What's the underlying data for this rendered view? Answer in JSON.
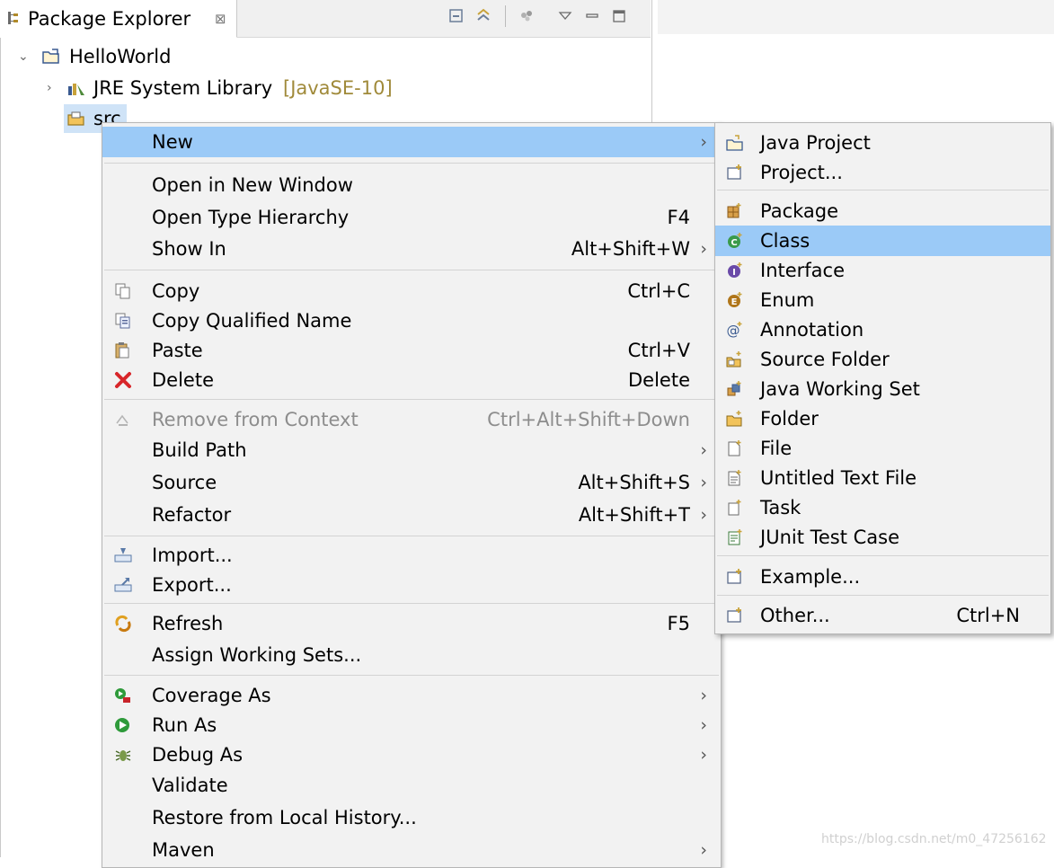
{
  "view": {
    "title": "Package Explorer",
    "close_glyph": "⊠",
    "toolbar": [
      "collapse-all-icon",
      "link-with-editor-icon",
      "filters-icon",
      "view-menu-icon",
      "minimize-icon",
      "maximize-icon"
    ]
  },
  "tree": [
    {
      "label": "HelloWorld",
      "decoration": "",
      "twisty": "⌄",
      "icon": "java-project-icon"
    },
    {
      "label": "JRE System Library",
      "decoration": "[JavaSE-10]",
      "twisty": "›",
      "icon": "library-icon"
    },
    {
      "label": "src",
      "decoration": "",
      "twisty": "",
      "icon": "source-folder-icon"
    }
  ],
  "context_menu": {
    "items": [
      {
        "label": "New",
        "accel": "",
        "arrow": "›",
        "icon": "",
        "highlighted": true
      },
      {
        "label": "Open in New Window",
        "accel": "",
        "arrow": "",
        "icon": ""
      },
      {
        "label": "Open Type Hierarchy",
        "accel": "F4",
        "arrow": "",
        "icon": ""
      },
      {
        "label": "Show In",
        "accel": "Alt+Shift+W",
        "arrow": "›",
        "icon": ""
      },
      {
        "label": "Copy",
        "accel": "Ctrl+C",
        "arrow": "",
        "icon": "copy-icon"
      },
      {
        "label": "Copy Qualified Name",
        "accel": "",
        "arrow": "",
        "icon": "copy-qualified-name-icon"
      },
      {
        "label": "Paste",
        "accel": "Ctrl+V",
        "arrow": "",
        "icon": "paste-icon"
      },
      {
        "label": "Delete",
        "accel": "Delete",
        "arrow": "",
        "icon": "delete-icon"
      },
      {
        "label": "Remove from Context",
        "accel": "Ctrl+Alt+Shift+Down",
        "arrow": "",
        "icon": "remove-context-icon",
        "disabled": true
      },
      {
        "label": "Build Path",
        "accel": "",
        "arrow": "›",
        "icon": ""
      },
      {
        "label": "Source",
        "accel": "Alt+Shift+S",
        "arrow": "›",
        "icon": ""
      },
      {
        "label": "Refactor",
        "accel": "Alt+Shift+T",
        "arrow": "›",
        "icon": ""
      },
      {
        "label": "Import...",
        "accel": "",
        "arrow": "",
        "icon": "import-icon"
      },
      {
        "label": "Export...",
        "accel": "",
        "arrow": "",
        "icon": "export-icon"
      },
      {
        "label": "Refresh",
        "accel": "F5",
        "arrow": "",
        "icon": "refresh-icon"
      },
      {
        "label": "Assign Working Sets...",
        "accel": "",
        "arrow": "",
        "icon": ""
      },
      {
        "label": "Coverage As",
        "accel": "",
        "arrow": "›",
        "icon": "coverage-icon"
      },
      {
        "label": "Run As",
        "accel": "",
        "arrow": "›",
        "icon": "run-icon"
      },
      {
        "label": "Debug As",
        "accel": "",
        "arrow": "›",
        "icon": "debug-icon"
      },
      {
        "label": "Validate",
        "accel": "",
        "arrow": "",
        "icon": ""
      },
      {
        "label": "Restore from Local History...",
        "accel": "",
        "arrow": "",
        "icon": ""
      },
      {
        "label": "Maven",
        "accel": "",
        "arrow": "›",
        "icon": ""
      }
    ]
  },
  "new_submenu": {
    "items": [
      {
        "label": "Java Project",
        "accel": "",
        "icon": "java-project-wizard-icon"
      },
      {
        "label": "Project...",
        "accel": "",
        "icon": "project-wizard-icon"
      },
      {
        "label": "Package",
        "accel": "",
        "icon": "package-icon"
      },
      {
        "label": "Class",
        "accel": "",
        "icon": "class-icon",
        "highlighted": true
      },
      {
        "label": "Interface",
        "accel": "",
        "icon": "interface-icon"
      },
      {
        "label": "Enum",
        "accel": "",
        "icon": "enum-icon"
      },
      {
        "label": "Annotation",
        "accel": "",
        "icon": "annotation-icon"
      },
      {
        "label": "Source Folder",
        "accel": "",
        "icon": "source-folder-wizard-icon"
      },
      {
        "label": "Java Working Set",
        "accel": "",
        "icon": "working-set-icon"
      },
      {
        "label": "Folder",
        "accel": "",
        "icon": "folder-icon"
      },
      {
        "label": "File",
        "accel": "",
        "icon": "file-icon"
      },
      {
        "label": "Untitled Text File",
        "accel": "",
        "icon": "text-file-icon"
      },
      {
        "label": "Task",
        "accel": "",
        "icon": "task-icon"
      },
      {
        "label": "JUnit Test Case",
        "accel": "",
        "icon": "junit-icon"
      },
      {
        "label": "Example...",
        "accel": "",
        "icon": "example-icon"
      },
      {
        "label": "Other...",
        "accel": "Ctrl+N",
        "icon": "other-wizard-icon"
      }
    ]
  },
  "watermark": "https://blog.csdn.net/m0_47256162",
  "colors": {
    "highlight": "#9bcaf7",
    "selection": "#cfe3f7",
    "menu_bg": "#f2f2f2"
  }
}
